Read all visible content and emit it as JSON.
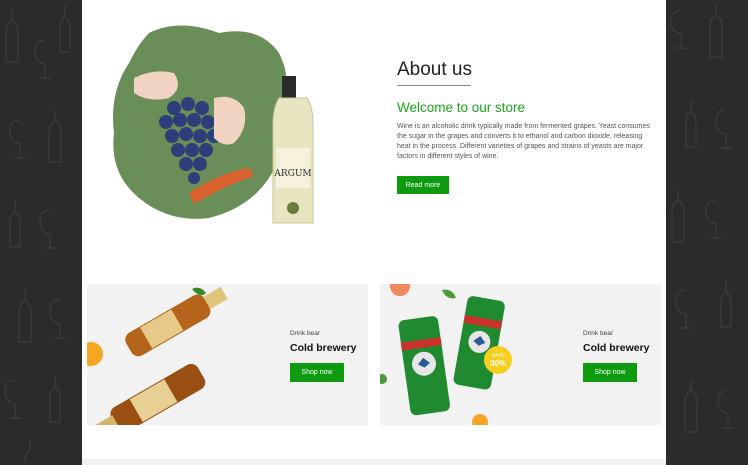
{
  "about": {
    "title": "About us",
    "welcome": "Welcome to our store",
    "description": "Wine is an alcoholic drink typically made from fermented grapes. Yeast consumes the sugar in the grapes and converts it to ethanol and carbon dioxide, releasing heat in the process. Different varieties of grapes and strains of yeasts are major factors in different styles of wine.",
    "button": "Read more",
    "bottle_label": "ARGUM"
  },
  "banners": [
    {
      "small": "Drink bear",
      "title": "Cold brewery",
      "button": "Shop now"
    },
    {
      "small": "Drink bear",
      "title": "Cold brewery",
      "button": "Shop now",
      "badge_top": "SAVE",
      "badge_value": "30%"
    }
  ],
  "colors": {
    "accent": "#0f9b0f",
    "welcome": "#1aa51a",
    "side": "#2b2b2b"
  }
}
